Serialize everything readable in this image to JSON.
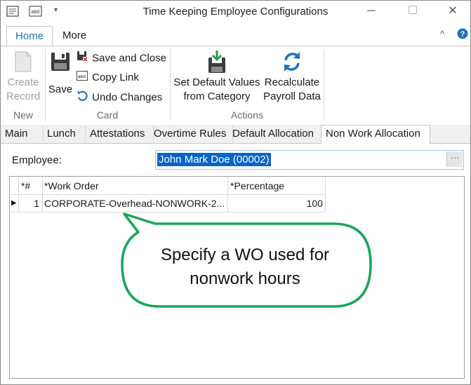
{
  "window": {
    "title": "Time Keeping Employee Configurations"
  },
  "ribbon": {
    "tabs": [
      {
        "label": "Home"
      },
      {
        "label": "More"
      }
    ],
    "new_group": {
      "label": "New",
      "create_record": "Create Record"
    },
    "card_group": {
      "label": "Card",
      "save": "Save",
      "save_close": "Save and Close",
      "copy_link": "Copy Link",
      "undo": "Undo Changes"
    },
    "actions_group": {
      "label": "Actions",
      "set_defaults": "Set Default Values from Category",
      "recalc": "Recalculate Payroll Data"
    }
  },
  "page_tabs": [
    {
      "label": "Main"
    },
    {
      "label": "Lunch"
    },
    {
      "label": "Attestations"
    },
    {
      "label": "Overtime Rules"
    },
    {
      "label": "Default Allocation"
    },
    {
      "label": "Non Work Allocation"
    }
  ],
  "employee": {
    "label": "Employee:",
    "value": "John Mark Doe (00002)"
  },
  "grid": {
    "columns": [
      {
        "label": "*#"
      },
      {
        "label": "*Work Order"
      },
      {
        "label": "*Percentage"
      }
    ],
    "rows": [
      {
        "index": "1",
        "work_order": "CORPORATE-Overhead-NONWORK-2...",
        "percentage": "100"
      }
    ]
  },
  "callout": {
    "line1": "Specify a WO used for",
    "line2": "nonwork hours"
  },
  "colors": {
    "accent": "#1e73be",
    "selection": "#0a64c8",
    "callout_border": "#1aa55a"
  }
}
